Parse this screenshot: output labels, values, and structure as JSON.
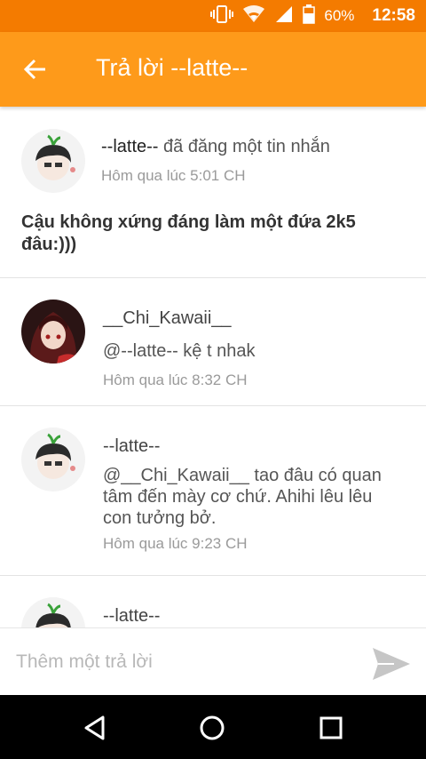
{
  "status_bar": {
    "battery_percent": "60%",
    "time": "12:58"
  },
  "app_bar": {
    "title": "Trả lời --latte--"
  },
  "post": {
    "author": "--latte--",
    "action": " đã đăng một tin nhắn",
    "time": "Hôm qua lúc 5:01 CH",
    "message": "Cậu không xứng đáng làm một đứa 2k5 đâu:)))"
  },
  "replies": [
    {
      "name": "__Chi_Kawaii__",
      "text": "@--latte--  kệ t nhak",
      "time": "Hôm qua lúc 8:32 CH"
    },
    {
      "name": "--latte--",
      "text": "@__Chi_Kawaii__  tao đâu có quan tâm đến mày cơ chứ. Ahihi lêu lêu con tưởng bở.",
      "time": "Hôm qua lúc 9:23 CH"
    },
    {
      "name": "--latte--"
    }
  ],
  "input": {
    "placeholder": "Thêm một trả lời"
  },
  "colors": {
    "status_bar": "#f47b00",
    "app_bar": "#fe9a1a"
  }
}
